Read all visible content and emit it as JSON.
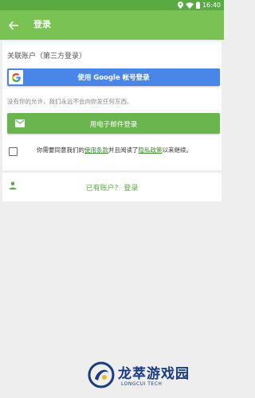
{
  "status_bar": {
    "time": "16:40",
    "icons": [
      "location-icon",
      "wifi-icon",
      "battery-icon"
    ]
  },
  "app_bar": {
    "title": "登录",
    "back_icon": "arrow-back-icon",
    "background": "#7ac254"
  },
  "main_card": {
    "section_label": "关联账户（第三方登录）",
    "google_button": {
      "label": "使用 Google 帐号登录",
      "icon": "google-g-icon",
      "color": "#4a86e8"
    },
    "privacy_note": "没有你的允许，我们永远不会向你发任何东西。",
    "email_button": {
      "label": "用电子邮件登录",
      "icon": "mail-icon",
      "color": "#6ab54e"
    },
    "terms": {
      "prefix": "你需要同意我们的",
      "terms_link": "使用条款",
      "middle": "并且阅读了",
      "privacy_link": "隐私政策",
      "suffix": "以来继续。",
      "checked": false
    }
  },
  "login_card": {
    "label": "已有账户？ 登录",
    "icon": "person-icon"
  },
  "watermark": {
    "title": "龙萃游戏园",
    "subtitle": "LONGCUI TECH"
  }
}
